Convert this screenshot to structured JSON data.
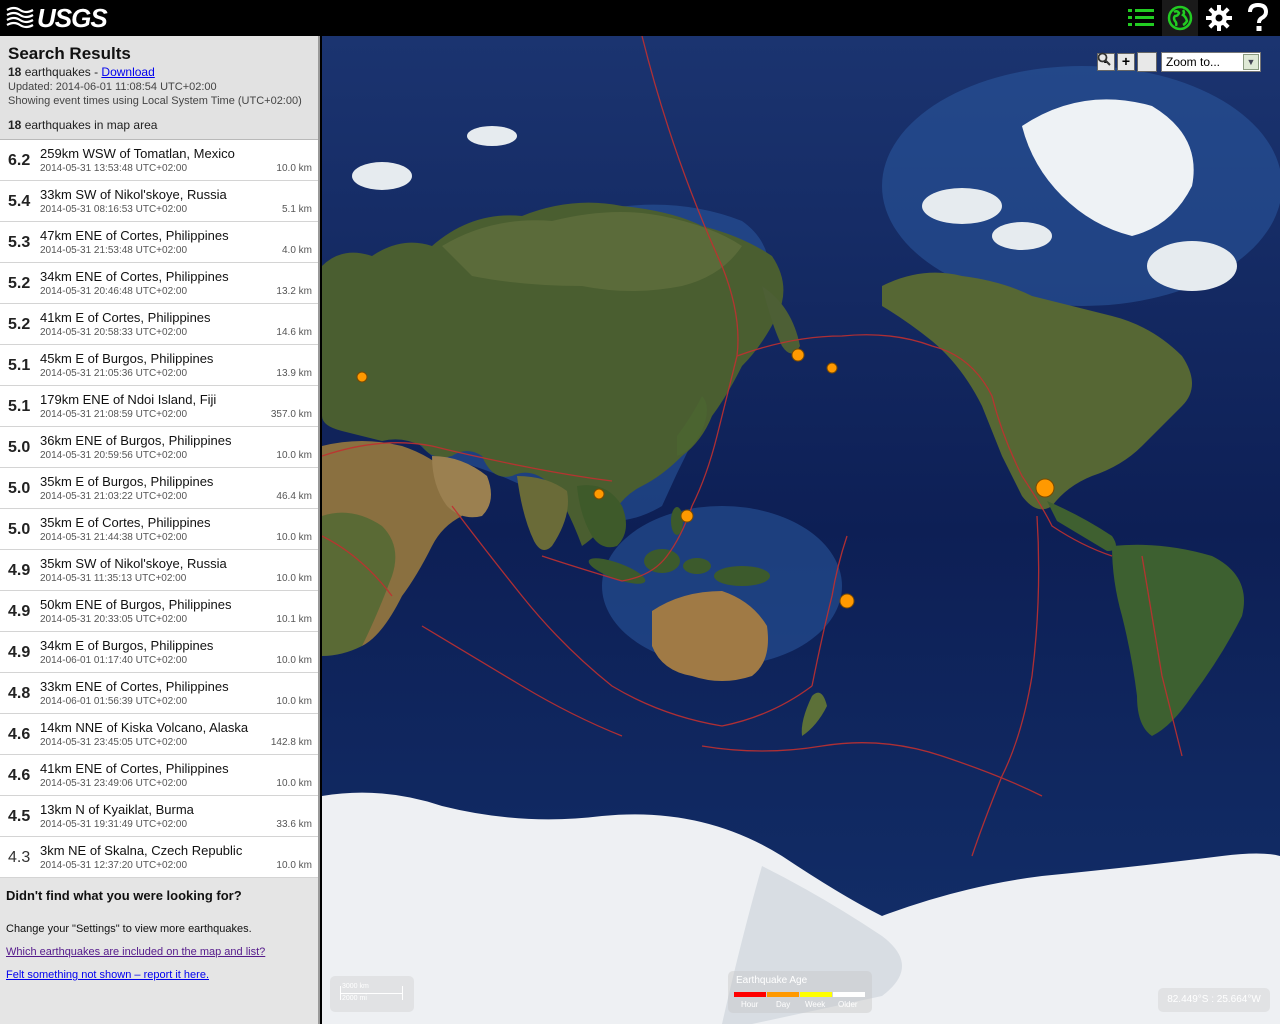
{
  "header": {
    "logo_text": "USGS"
  },
  "summary": {
    "title": "Search Results",
    "count_bold": "18",
    "count_text": " earthquakes - ",
    "download_label": "Download",
    "updated": "Updated: 2014-06-01 11:08:54 UTC+02:00",
    "showing": "Showing event times using Local System Time (UTC+02:00)",
    "map_area_bold": "18",
    "map_area_text": " earthquakes in map area"
  },
  "earthquakes": [
    {
      "mag": "6.2",
      "place": "259km WSW of Tomatlan, Mexico",
      "time": "2014-05-31 13:53:48 UTC+02:00",
      "depth": "10.0 km"
    },
    {
      "mag": "5.4",
      "place": "33km SW of Nikol'skoye, Russia",
      "time": "2014-05-31 08:16:53 UTC+02:00",
      "depth": "5.1 km"
    },
    {
      "mag": "5.3",
      "place": "47km ENE of Cortes, Philippines",
      "time": "2014-05-31 21:53:48 UTC+02:00",
      "depth": "4.0 km"
    },
    {
      "mag": "5.2",
      "place": "34km ENE of Cortes, Philippines",
      "time": "2014-05-31 20:46:48 UTC+02:00",
      "depth": "13.2 km"
    },
    {
      "mag": "5.2",
      "place": "41km E of Cortes, Philippines",
      "time": "2014-05-31 20:58:33 UTC+02:00",
      "depth": "14.6 km"
    },
    {
      "mag": "5.1",
      "place": "45km E of Burgos, Philippines",
      "time": "2014-05-31 21:05:36 UTC+02:00",
      "depth": "13.9 km"
    },
    {
      "mag": "5.1",
      "place": "179km ENE of Ndoi Island, Fiji",
      "time": "2014-05-31 21:08:59 UTC+02:00",
      "depth": "357.0 km"
    },
    {
      "mag": "5.0",
      "place": "36km ENE of Burgos, Philippines",
      "time": "2014-05-31 20:59:56 UTC+02:00",
      "depth": "10.0 km"
    },
    {
      "mag": "5.0",
      "place": "35km E of Burgos, Philippines",
      "time": "2014-05-31 21:03:22 UTC+02:00",
      "depth": "46.4 km"
    },
    {
      "mag": "5.0",
      "place": "35km E of Cortes, Philippines",
      "time": "2014-05-31 21:44:38 UTC+02:00",
      "depth": "10.0 km"
    },
    {
      "mag": "4.9",
      "place": "35km SW of Nikol'skoye, Russia",
      "time": "2014-05-31 11:35:13 UTC+02:00",
      "depth": "10.0 km"
    },
    {
      "mag": "4.9",
      "place": "50km ENE of Burgos, Philippines",
      "time": "2014-05-31 20:33:05 UTC+02:00",
      "depth": "10.1 km"
    },
    {
      "mag": "4.9",
      "place": "34km E of Burgos, Philippines",
      "time": "2014-06-01 01:17:40 UTC+02:00",
      "depth": "10.0 km"
    },
    {
      "mag": "4.8",
      "place": "33km ENE of Cortes, Philippines",
      "time": "2014-06-01 01:56:39 UTC+02:00",
      "depth": "10.0 km"
    },
    {
      "mag": "4.6",
      "place": "14km NNE of Kiska Volcano, Alaska",
      "time": "2014-05-31 23:45:05 UTC+02:00",
      "depth": "142.8 km"
    },
    {
      "mag": "4.6",
      "place": "41km ENE of Cortes, Philippines",
      "time": "2014-05-31 23:49:06 UTC+02:00",
      "depth": "10.0 km"
    },
    {
      "mag": "4.5",
      "place": "13km N of Kyaiklat, Burma",
      "time": "2014-05-31 19:31:49 UTC+02:00",
      "depth": "33.6 km"
    },
    {
      "mag": "4.3",
      "place": "3km NE of Skalna, Czech Republic",
      "time": "2014-05-31 12:37:20 UTC+02:00",
      "depth": "10.0 km"
    }
  ],
  "help": {
    "heading": "Didn't find what you were looking for?",
    "settings_text": "Change your \"Settings\" to view more earthquakes.",
    "included_link": "Which earthquakes are included on the map and list?",
    "felt_link": "Felt something not shown – report it here."
  },
  "map": {
    "zoom_out": "-",
    "zoom_in": "+",
    "zoom_select": "Zoom to...",
    "scale_km": "3000 km",
    "scale_mi": "2000 mi",
    "legend_title": "Earthquake Age",
    "legend": [
      {
        "label": "Hour",
        "color": "#ff0000"
      },
      {
        "label": "Day",
        "color": "#ff9900"
      },
      {
        "label": "Week",
        "color": "#ffff00"
      },
      {
        "label": "Older",
        "color": "#ffffff"
      }
    ],
    "coords": "82.449°S : 25.664°W",
    "marker_color": "#ff9900"
  }
}
